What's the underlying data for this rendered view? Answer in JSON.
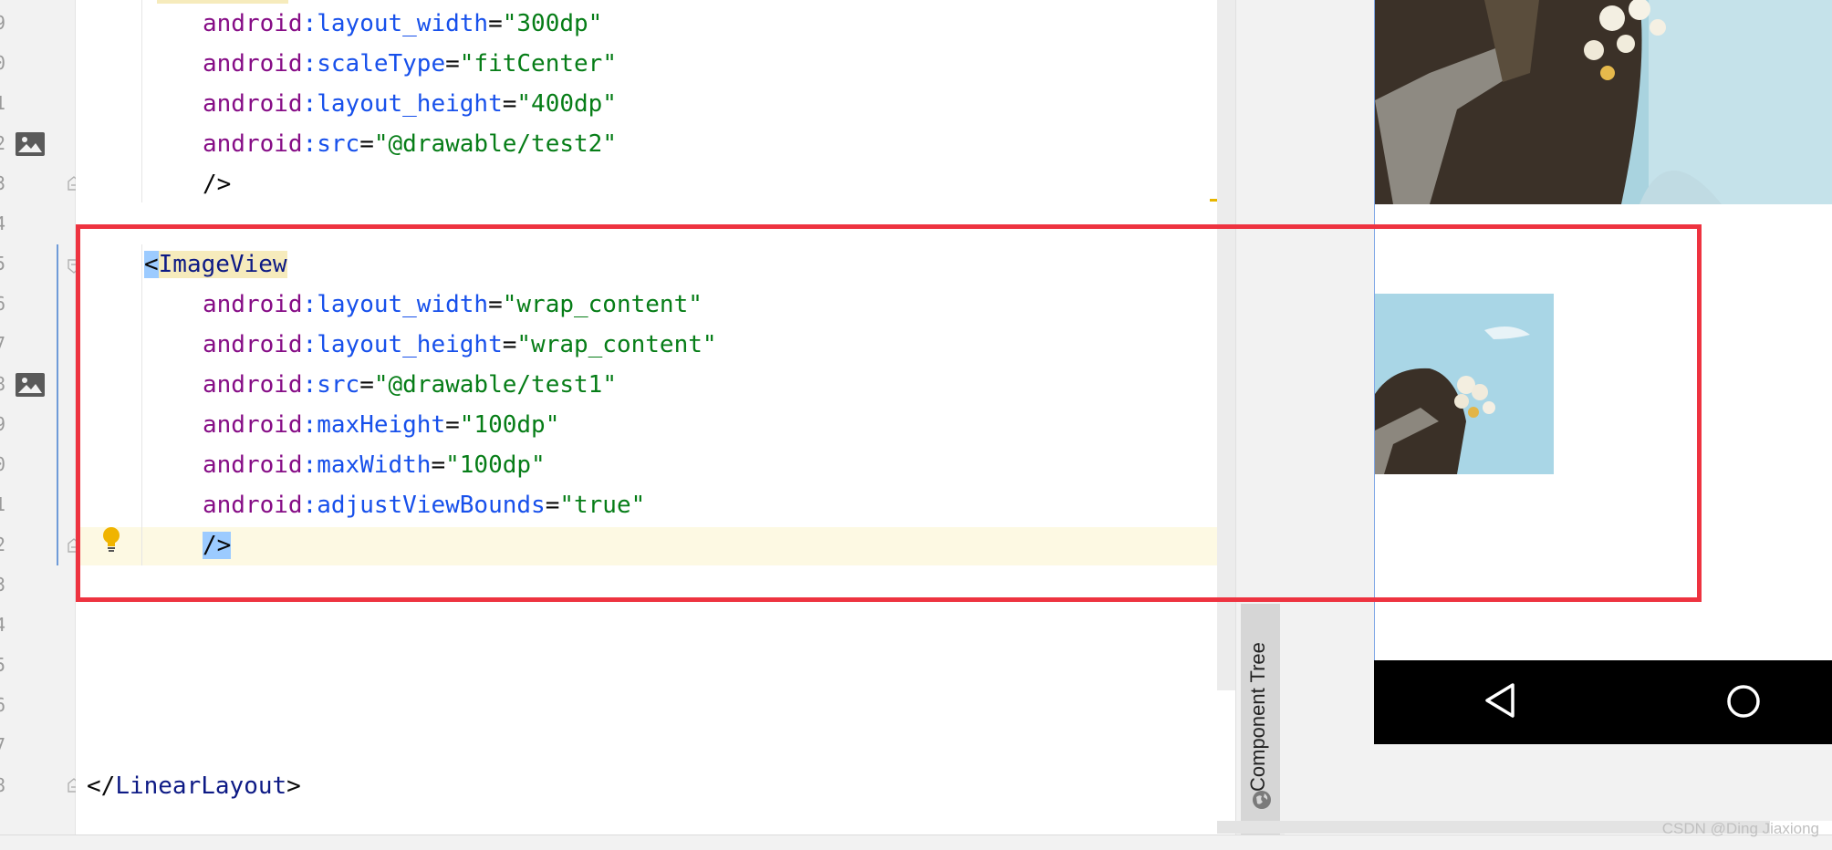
{
  "gutter": {
    "line_numbers": [
      "9",
      "0",
      "1",
      "2",
      "3",
      "4",
      "5",
      "6",
      "7",
      "8",
      "9",
      "0",
      "1",
      "2",
      "3",
      "4",
      "5",
      "6",
      "7",
      "8"
    ]
  },
  "code": {
    "line1": {
      "ns": "android",
      "attr": ":layout_width",
      "eq": "=",
      "val": "\"300dp\""
    },
    "line2": {
      "ns": "android",
      "attr": ":scaleType",
      "eq": "=",
      "val": "\"fitCenter\""
    },
    "line3": {
      "ns": "android",
      "attr": ":layout_height",
      "eq": "=",
      "val": "\"400dp\""
    },
    "line4": {
      "ns": "android",
      "attr": ":src",
      "eq": "=",
      "val": "\"@drawable/test2\""
    },
    "line5_close": "/>",
    "line6": {
      "open_bracket": "<",
      "tag": "ImageView"
    },
    "line7": {
      "ns": "android",
      "attr": ":layout_width",
      "eq": "=",
      "val": "\"wrap_content\""
    },
    "line8": {
      "ns": "android",
      "attr": ":layout_height",
      "eq": "=",
      "val": "\"wrap_content\""
    },
    "line9": {
      "ns": "android",
      "attr": ":src",
      "eq": "=",
      "val": "\"@drawable/test1\""
    },
    "line10": {
      "ns": "android",
      "attr": ":maxHeight",
      "eq": "=",
      "val": "\"100dp\""
    },
    "line11": {
      "ns": "android",
      "attr": ":maxWidth",
      "eq": "=",
      "val": "\"100dp\""
    },
    "line12": {
      "ns": "android",
      "attr": ":adjustViewBounds",
      "eq": "=",
      "val": "\"true\""
    },
    "line13_close": "/>",
    "closing": {
      "open": "</",
      "tag": "LinearLayout",
      "close": ">"
    }
  },
  "sidebar": {
    "component_tree_label": "Component Tree"
  },
  "watermark": "CSDN @Ding Jiaxiong",
  "colors": {
    "namespace": "#860d86",
    "attribute": "#1750eb",
    "value": "#067d17",
    "tag": "#0d1a85",
    "highlight_box": "#ee3340",
    "caret_row": "#fdf9e3"
  },
  "icons": [
    "image-icon",
    "fold-icon",
    "lightbulb-icon",
    "globe-icon",
    "nav-back-icon",
    "nav-home-icon"
  ]
}
